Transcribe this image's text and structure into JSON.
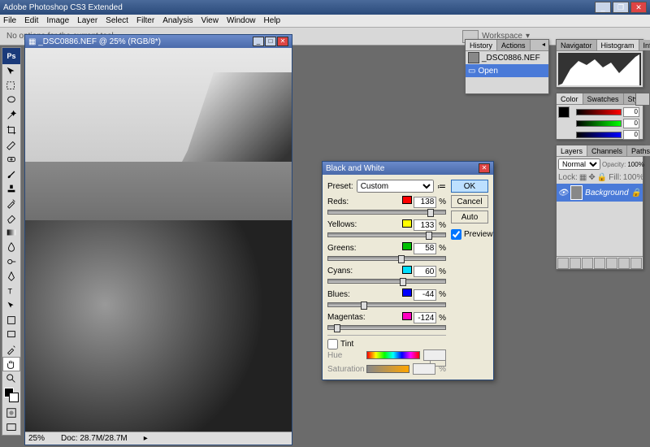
{
  "app": {
    "title": "Adobe Photoshop CS3 Extended"
  },
  "menu": [
    "File",
    "Edit",
    "Image",
    "Layer",
    "Select",
    "Filter",
    "Analysis",
    "View",
    "Window",
    "Help"
  ],
  "options": {
    "message": "No options for the current tool.",
    "workspace": "Workspace"
  },
  "doc": {
    "title": "_DSC0886.NEF @ 25% (RGB/8*)",
    "zoom": "25%",
    "docinfo": "Doc: 28.7M/28.7M"
  },
  "dialog": {
    "title": "Black and White",
    "preset_label": "Preset:",
    "preset_value": "Custom",
    "ok": "OK",
    "cancel": "Cancel",
    "auto": "Auto",
    "preview": "Preview",
    "channels": [
      {
        "name": "Reds:",
        "color": "#ff0000",
        "value": "138",
        "pos": 85
      },
      {
        "name": "Yellows:",
        "color": "#ffff00",
        "value": "133",
        "pos": 83
      },
      {
        "name": "Greens:",
        "color": "#00c000",
        "value": "58",
        "pos": 60
      },
      {
        "name": "Cyans:",
        "color": "#00e0ff",
        "value": "60",
        "pos": 61
      },
      {
        "name": "Blues:",
        "color": "#0000ff",
        "value": "-44",
        "pos": 28
      },
      {
        "name": "Magentas:",
        "color": "#ff00c0",
        "value": "-124",
        "pos": 5
      }
    ],
    "tint": "Tint",
    "hue": "Hue",
    "sat": "Saturation",
    "pct": "%"
  },
  "panels": {
    "history": {
      "tabs": [
        "History",
        "Actions"
      ],
      "doc": "_DSC0886.NEF",
      "step": "Open"
    },
    "nav": {
      "tabs": [
        "Navigator",
        "Histogram",
        "Info"
      ]
    },
    "color": {
      "tabs": [
        "Color",
        "Swatches",
        "Styles"
      ],
      "rgb": [
        "0",
        "0",
        "0"
      ]
    },
    "layers": {
      "tabs": [
        "Layers",
        "Channels",
        "Paths"
      ],
      "mode": "Normal",
      "opacity": "Opacity:",
      "opval": "100%",
      "lock": "Lock:",
      "fill": "Fill:",
      "fillval": "100%",
      "bg": "Background"
    }
  }
}
